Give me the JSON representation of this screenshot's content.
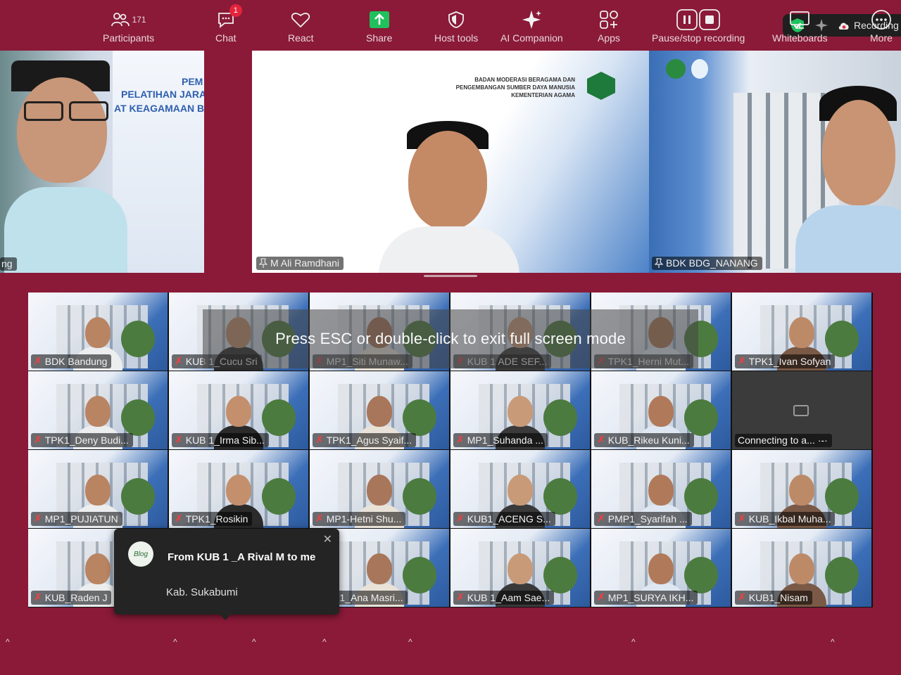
{
  "status": {
    "recording_label": "Recording"
  },
  "speakers": [
    {
      "name": "ng"
    },
    {
      "name": "M Ali Ramdhani",
      "slide_line1": "BADAN MODERASI BERAGAMA DAN",
      "slide_line2": "PENGEMBANGAN SUMBER DAYA MANUSIA",
      "slide_line3": "KEMENTERIAN AGAMA"
    },
    {
      "name": "BDK BDG_NANANG"
    }
  ],
  "left_banner": {
    "line1": "PEM",
    "line2": "PELATIHAN JARA",
    "line3": "AT KEAGAMAAN B"
  },
  "fullscreen_notice": "Press ESC or double-click to exit full screen mode",
  "gallery": [
    "BDK Bandung",
    "KUB 1_Cucu Sri",
    "MP1_Siti Munaw...",
    "KUB 1 ADE SEF...",
    "TPK1_Herni Mut...",
    "TPK1_Ivan Sofyan",
    "TPK1_Deny Budi...",
    "KUB 1_Irma Sib...",
    "TPK1_Agus Syaif...",
    "MP1_Suhanda ...",
    "KUB_Rikeu Kuni...",
    "Connecting to a...",
    "MP1_PUJIATUN",
    "TPK1_Rosikin",
    "MP1-Hetni Shu...",
    "KUB1_ACENG S...",
    "PMP1_Syarifah ...",
    "KUB_Ikbal Muha...",
    "KUB_Raden J",
    "",
    "PK1_Ana Masri...",
    "KUB 1_Aam Sae...",
    "MP1_SURYA IKH...",
    "KUB1_Nisam"
  ],
  "chat_popup": {
    "from": "From KUB 1 _A Rival M to me",
    "message": "Kab. Sukabumi",
    "avatar_text": "Blog"
  },
  "toolbar": {
    "participants": {
      "label": "Participants",
      "count": "171"
    },
    "chat": {
      "label": "Chat",
      "badge": "1"
    },
    "react": {
      "label": "React"
    },
    "share": {
      "label": "Share"
    },
    "host_tools": {
      "label": "Host tools"
    },
    "ai_companion": {
      "label": "AI Companion"
    },
    "apps": {
      "label": "Apps"
    },
    "pause_recording": {
      "label": "Pause/stop recording"
    },
    "whiteboards": {
      "label": "Whiteboards"
    },
    "more": {
      "label": "More"
    }
  },
  "colors": {
    "background": "#8a1a38",
    "active_speaker": "#24c26b",
    "share_green": "#20c05c",
    "mute_red": "#ff3b3b"
  }
}
